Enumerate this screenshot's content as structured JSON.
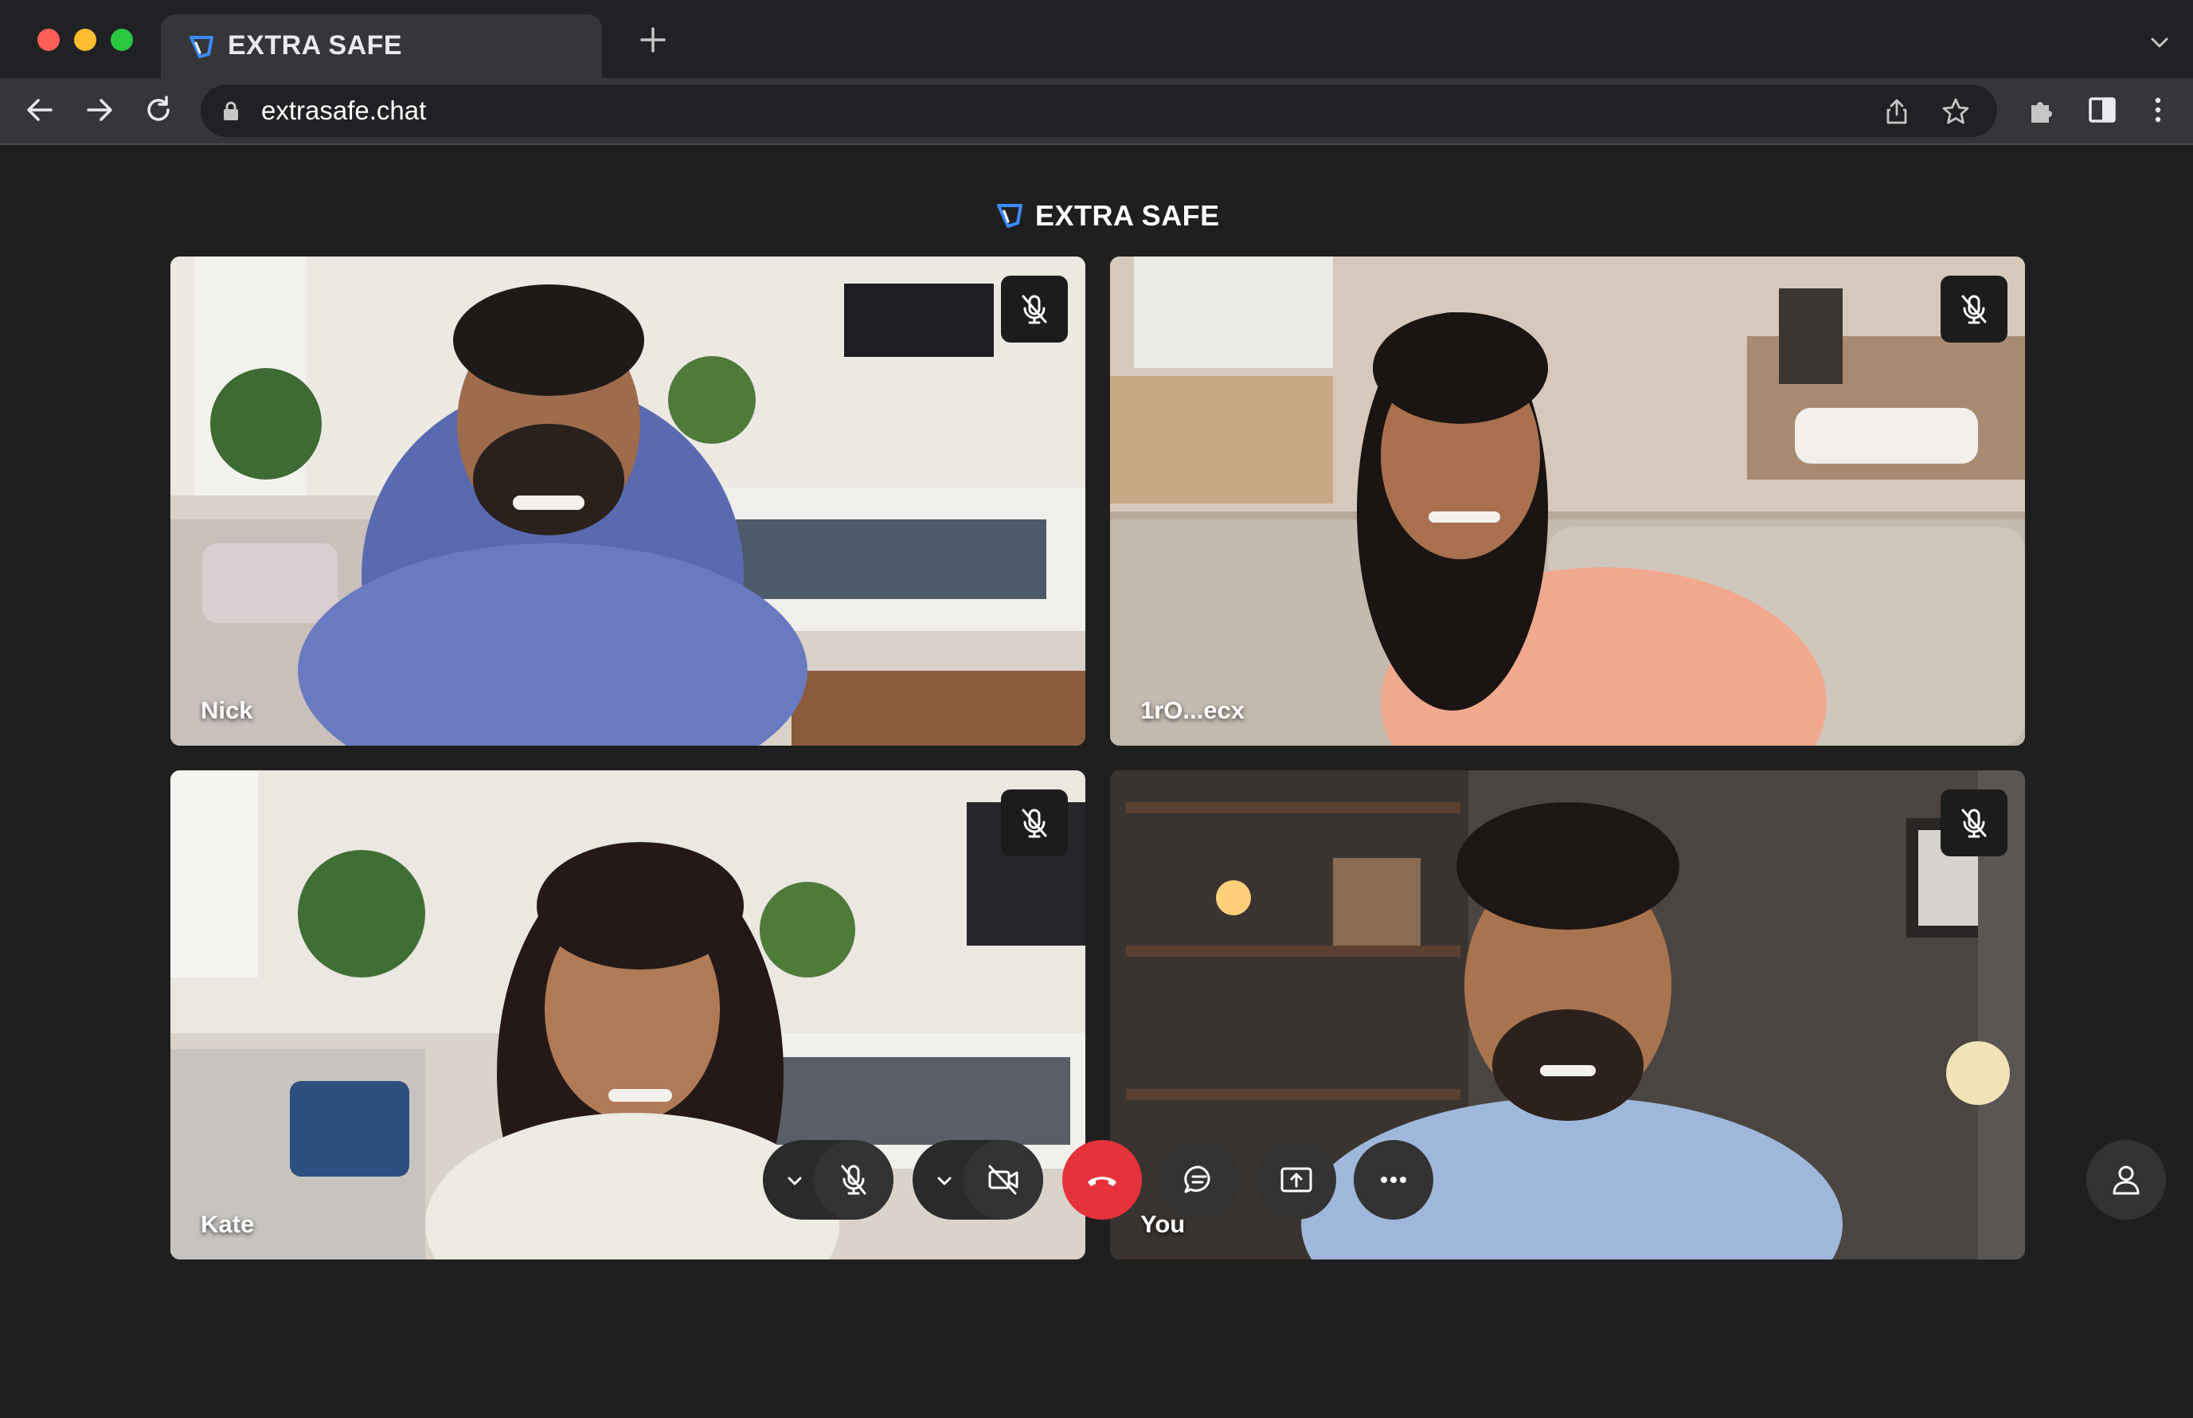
{
  "browser": {
    "tab_title": "EXTRA SAFE",
    "url": "extrasafe.chat"
  },
  "app": {
    "brand": "EXTRA SAFE",
    "accent_color": "#3d8bff",
    "end_call_color": "#e5323b"
  },
  "participants": [
    {
      "name": "Nick",
      "muted": true
    },
    {
      "name": "1rO...ecx",
      "muted": true
    },
    {
      "name": "Kate",
      "muted": true
    },
    {
      "name": "You",
      "muted": true
    }
  ],
  "controls": [
    {
      "icon": "microphone-off-icon"
    },
    {
      "icon": "camera-off-icon"
    },
    {
      "icon": "phone-hangup-icon"
    },
    {
      "icon": "chat-icon"
    },
    {
      "icon": "screen-share-icon"
    },
    {
      "icon": "more-icon"
    },
    {
      "icon": "person-icon"
    }
  ]
}
